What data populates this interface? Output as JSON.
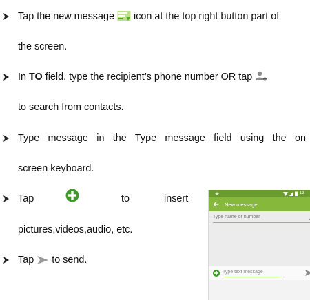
{
  "steps": [
    {
      "line1_pre": "Tap the new message ",
      "line1_post": " icon at the top right button part of",
      "line2": "the screen."
    },
    {
      "line1_pre": "In ",
      "line1_bold": "TO",
      "line1_post": " field, type the recipient’s phone number OR tap ",
      "line2": "to search from contacts."
    },
    {
      "line1": "Type message in the Type message field using the on",
      "line2": "screen keyboard."
    },
    {
      "w1": "Tap",
      "w2": "to",
      "w3": "insert",
      "line2": "pictures,videos,audio, etc."
    },
    {
      "line1_pre": "Tap ",
      "line1_post": " to send."
    }
  ],
  "phone": {
    "status_time": "13",
    "title": "New message",
    "to_placeholder": "Type name or number",
    "message_placeholder": "Type text message"
  },
  "colors": {
    "accent_green": "#86b83c",
    "status_green": "#6a9b2e",
    "plus_green": "#3f9a2a",
    "send_gray": "#9a9a9a"
  }
}
